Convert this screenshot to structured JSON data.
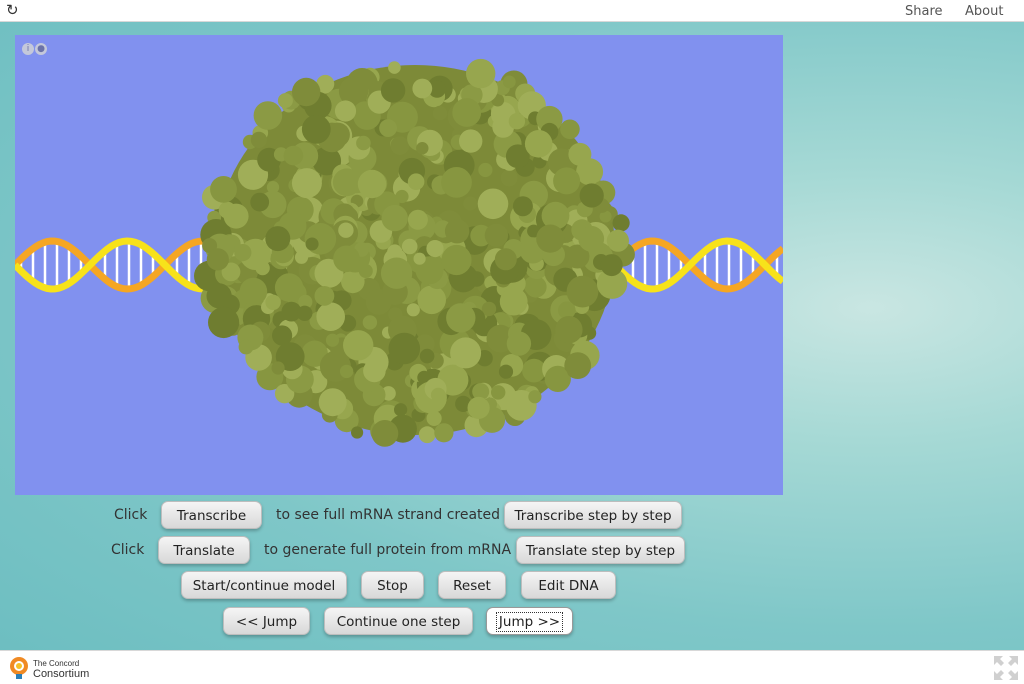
{
  "topbar": {
    "reload_icon": "reload-icon",
    "share_label": "Share",
    "about_label": "About"
  },
  "model": {
    "background_color": "#8191ef",
    "info_icon": "info-icon",
    "lock_icon": "lock-icon"
  },
  "controls": {
    "row1": {
      "prefix": "Click",
      "transcribe_label": "Transcribe",
      "middle_text": "to see full mRNA strand created or",
      "transcribe_step_label": "Transcribe step by step"
    },
    "row2": {
      "prefix": "Click",
      "translate_label": "Translate",
      "middle_text": "to generate full protein from mRNA or",
      "translate_step_label": "Translate step by step"
    },
    "row3": {
      "start_label": "Start/continue model",
      "stop_label": "Stop",
      "reset_label": "Reset",
      "edit_dna_label": "Edit DNA"
    },
    "row4": {
      "jump_back_label": "<< Jump",
      "continue_step_label": "Continue one step",
      "jump_forward_label": "Jump >>"
    }
  },
  "footer": {
    "logo_line1": "The Concord",
    "logo_line2": "Consortium",
    "fullscreen_icon": "fullscreen-icon"
  }
}
